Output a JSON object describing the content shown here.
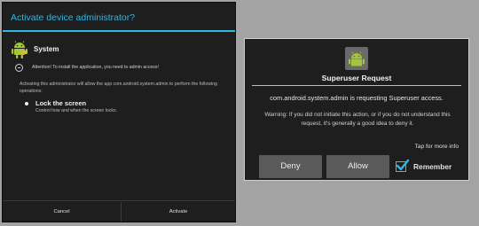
{
  "activate_dialog": {
    "title": "Activate device administrator?",
    "app_name": "System",
    "attention": "Attention! To install the application, you need to admin access!",
    "description": "Activating this administrator will allow the app com.android.system.admin to perform the following operations:",
    "policy_title": "Lock the screen",
    "policy_desc": "Control how and when the screen locks.",
    "cancel_label": "Cancel",
    "activate_label": "Activate",
    "accent_color": "#33b5e5"
  },
  "superuser_dialog": {
    "title": "Superuser Request",
    "message": "com.android.system.admin is requesting Superuser access.",
    "warning": "Warning: If you did not initiate this action, or if you do not understand this request, it's generally a good idea to deny it.",
    "more_info": "Tap for more info",
    "deny_label": "Deny",
    "allow_label": "Allow",
    "remember_label": "Remember",
    "remember_checked": true,
    "accent_color": "#33b5e5"
  },
  "icons": [
    "android-app-icon",
    "info-icon",
    "superuser-android-icon",
    "checkmark-icon"
  ]
}
